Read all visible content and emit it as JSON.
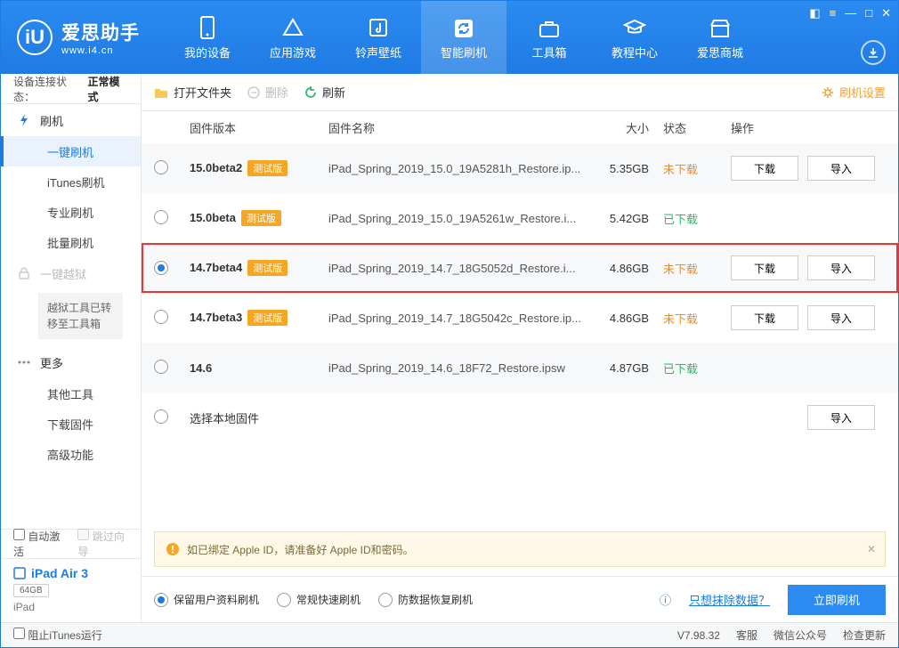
{
  "app": {
    "name_cn": "爱思助手",
    "name_en": "www.i4.cn"
  },
  "nav": [
    {
      "label": "我的设备"
    },
    {
      "label": "应用游戏"
    },
    {
      "label": "铃声壁纸"
    },
    {
      "label": "智能刷机"
    },
    {
      "label": "工具箱"
    },
    {
      "label": "教程中心"
    },
    {
      "label": "爱思商城"
    }
  ],
  "conn_state": {
    "prefix": "设备连接状态：",
    "value": "正常模式"
  },
  "sidebar": {
    "flash": {
      "title": "刷机",
      "items": [
        "一键刷机",
        "iTunes刷机",
        "专业刷机",
        "批量刷机"
      ]
    },
    "jailbreak": {
      "title": "一键越狱",
      "note": "越狱工具已转移至工具箱"
    },
    "more": {
      "title": "更多",
      "items": [
        "其他工具",
        "下载固件",
        "高级功能"
      ]
    }
  },
  "side_bottom": {
    "auto_activate": "自动激活",
    "skip_guide": "跳过向导",
    "device_name": "iPad Air 3",
    "device_storage": "64GB",
    "device_type": "iPad"
  },
  "toolbar": {
    "open_folder": "打开文件夹",
    "delete": "删除",
    "refresh": "刷新",
    "settings": "刷机设置"
  },
  "columns": {
    "version": "固件版本",
    "name": "固件名称",
    "size": "大小",
    "status": "状态",
    "ops": "操作"
  },
  "beta_tag": "测试版",
  "ops": {
    "download": "下载",
    "import": "导入"
  },
  "rows": [
    {
      "version": "15.0beta2",
      "beta": true,
      "name": "iPad_Spring_2019_15.0_19A5281h_Restore.ip...",
      "size": "5.35GB",
      "status": "未下载",
      "status_cls": "orange",
      "selected": false,
      "has_ops": true
    },
    {
      "version": "15.0beta",
      "beta": true,
      "name": "iPad_Spring_2019_15.0_19A5261w_Restore.i...",
      "size": "5.42GB",
      "status": "已下载",
      "status_cls": "green",
      "selected": false,
      "has_ops": false
    },
    {
      "version": "14.7beta4",
      "beta": true,
      "name": "iPad_Spring_2019_14.7_18G5052d_Restore.i...",
      "size": "4.86GB",
      "status": "未下载",
      "status_cls": "orange",
      "selected": true,
      "has_ops": true,
      "highlight": true
    },
    {
      "version": "14.7beta3",
      "beta": true,
      "name": "iPad_Spring_2019_14.7_18G5042c_Restore.ip...",
      "size": "4.86GB",
      "status": "未下载",
      "status_cls": "orange",
      "selected": false,
      "has_ops": true
    },
    {
      "version": "14.6",
      "beta": false,
      "name": "iPad_Spring_2019_14.6_18F72_Restore.ipsw",
      "size": "4.87GB",
      "status": "已下载",
      "status_cls": "green",
      "selected": false,
      "has_ops": false
    }
  ],
  "local_row": "选择本地固件",
  "notice": "如已绑定 Apple ID，请准备好 Apple ID和密码。",
  "action": {
    "opts": [
      "保留用户资料刷机",
      "常规快速刷机",
      "防数据恢复刷机"
    ],
    "erase_link": "只想抹除数据？",
    "flash_now": "立即刷机"
  },
  "footer": {
    "block_itunes": "阻止iTunes运行",
    "version": "V7.98.32",
    "service": "客服",
    "wechat": "微信公众号",
    "update": "检查更新"
  }
}
